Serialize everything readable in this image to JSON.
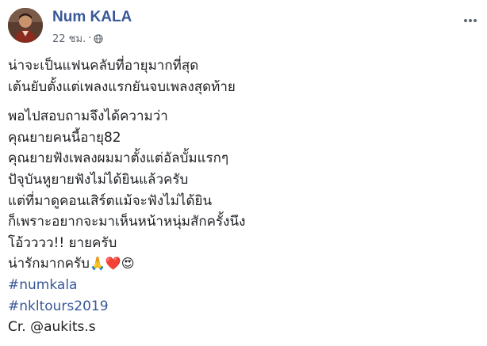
{
  "post": {
    "author": "Num KALA",
    "time": "22 ชม.",
    "separator": "·",
    "privacy_icon": "globe-icon",
    "more_icon": "more-options-icon",
    "paragraph1": [
      "น่าจะเป็นแฟนคลับที่อายุมากที่สุด",
      "เต้นยับตั้งแต่เพลงแรกยันจบเพลงสุดท้าย"
    ],
    "paragraph2": [
      "พอไปสอบถามจึงได้ความว่า",
      "คุณยายคนนี้อายุ82",
      "คุณยายฟังเพลงผมมาตั้งแต่อัลบั้มแรกๆ",
      "ปัจุบันหูยายฟังไม่ได้ยินแล้วครับ",
      "แต่ที่มาดูคอนเสิร์ตแม้จะฟังไม่ได้ยิน",
      "ก็เพราะอยากจะมาเห็นหน้าหนุ่มสักครั้งนึง",
      "โอ้วววว!! ยายครับ"
    ],
    "last_text": "น่ารักมากครับ",
    "emojis": {
      "pray": "🙏",
      "heart": "❤️",
      "heart_eyes": "😍"
    },
    "hashtags": [
      "#numkala",
      "#nkltours2019"
    ],
    "credit": "Cr. @aukits.s"
  },
  "colors": {
    "link": "#385898",
    "text": "#1c1e21",
    "meta": "#606770"
  }
}
